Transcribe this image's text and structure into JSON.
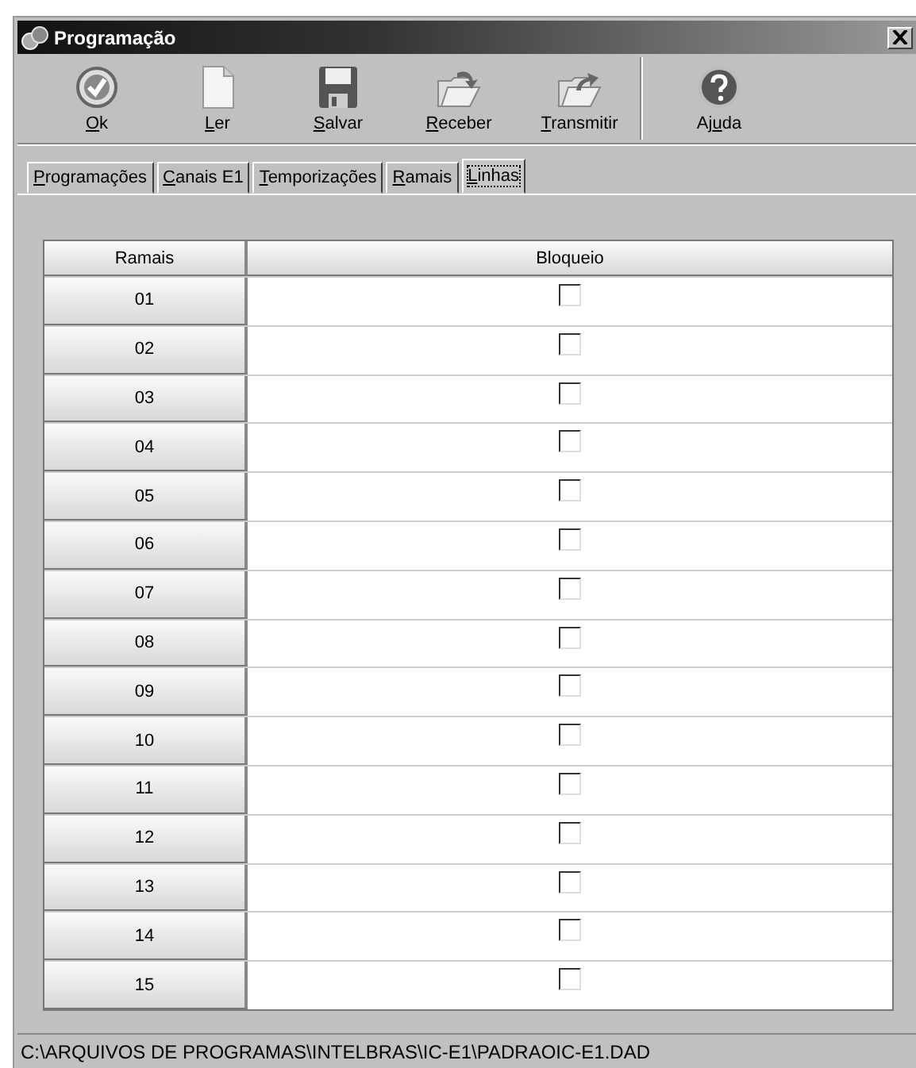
{
  "window": {
    "title": "Programação"
  },
  "toolbar": [
    {
      "kind": "ok",
      "key": "O",
      "rest": "k"
    },
    {
      "kind": "page",
      "key": "L",
      "rest": "er"
    },
    {
      "kind": "disk",
      "key": "S",
      "rest": "alvar"
    },
    {
      "kind": "receive",
      "key": "R",
      "rest": "eceber"
    },
    {
      "kind": "send",
      "key": "T",
      "rest": "ransmitir"
    },
    {
      "kind": "help",
      "lead": "Aj",
      "key": "u",
      "rest": "da"
    }
  ],
  "tabs": [
    {
      "key": "P",
      "rest": "rogramações",
      "selected": false
    },
    {
      "key": "C",
      "rest": "anais E1",
      "selected": false
    },
    {
      "key": "T",
      "rest": "emporizações",
      "selected": false
    },
    {
      "key": "R",
      "rest": "amais",
      "selected": false
    },
    {
      "key": "L",
      "rest": "inhas",
      "selected": true
    }
  ],
  "table": {
    "columns": [
      "Ramais",
      "Bloqueio"
    ],
    "rows": [
      {
        "ramal": "01",
        "checked": false
      },
      {
        "ramal": "02",
        "checked": false
      },
      {
        "ramal": "03",
        "checked": false
      },
      {
        "ramal": "04",
        "checked": false
      },
      {
        "ramal": "05",
        "checked": false
      },
      {
        "ramal": "06",
        "checked": false
      },
      {
        "ramal": "07",
        "checked": false
      },
      {
        "ramal": "08",
        "checked": false
      },
      {
        "ramal": "09",
        "checked": false
      },
      {
        "ramal": "10",
        "checked": false
      },
      {
        "ramal": "11",
        "checked": false
      },
      {
        "ramal": "12",
        "checked": false
      },
      {
        "ramal": "13",
        "checked": false
      },
      {
        "ramal": "14",
        "checked": false
      },
      {
        "ramal": "15",
        "checked": false
      }
    ]
  },
  "status_bar": "C:\\ARQUIVOS DE PROGRAMAS\\INTELBRAS\\IC-E1\\PADRAOIC-E1.DAD"
}
